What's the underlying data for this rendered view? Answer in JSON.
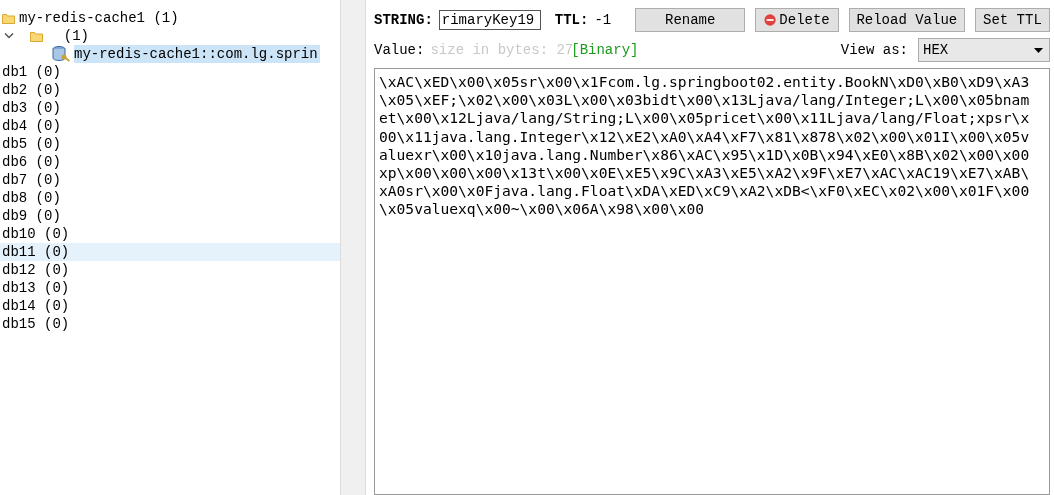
{
  "tree": {
    "connection": {
      "label": "my-redis-cache1 (1)",
      "children": [
        {
          "label": "(1)",
          "expanded": true,
          "children": [
            {
              "label": "my-redis-cache1::com.lg.sprin",
              "selected": true
            }
          ]
        }
      ]
    },
    "databases": [
      {
        "label": "db1 (0)",
        "hovered": false
      },
      {
        "label": "db2 (0)",
        "hovered": false
      },
      {
        "label": "db3 (0)",
        "hovered": false
      },
      {
        "label": "db4 (0)",
        "hovered": false
      },
      {
        "label": "db5 (0)",
        "hovered": false
      },
      {
        "label": "db6 (0)",
        "hovered": false
      },
      {
        "label": "db7 (0)",
        "hovered": false
      },
      {
        "label": "db8 (0)",
        "hovered": false
      },
      {
        "label": "db9 (0)",
        "hovered": false
      },
      {
        "label": "db10 (0)",
        "hovered": false
      },
      {
        "label": "db11 (0)",
        "hovered": true
      },
      {
        "label": "db12 (0)",
        "hovered": false
      },
      {
        "label": "db13 (0)",
        "hovered": false
      },
      {
        "label": "db14 (0)",
        "hovered": false
      },
      {
        "label": "db15 (0)",
        "hovered": false
      }
    ]
  },
  "key_bar": {
    "type_label": "STRING:",
    "key_value": "rimaryKey19",
    "ttl_label": "TTL:",
    "ttl_value": "-1",
    "buttons": [
      {
        "label": "Rename",
        "kind": "plain"
      },
      {
        "label": "Delete",
        "kind": "delete"
      },
      {
        "label": "Reload Value",
        "kind": "plain"
      },
      {
        "label": "Set TTL",
        "kind": "plain"
      }
    ]
  },
  "value_bar": {
    "label": "Value:",
    "size_placeholder": "size in bytes: 27",
    "format_tag": "[Binary]",
    "view_as_label": "View as:",
    "view_as_value": "HEX"
  },
  "value_lines": [
    "\\xAC\\xED\\x00\\x05sr\\x00\\x1Fcom.lg.springboot02.entity.BookN\\xD0\\xB0\\xD9\\xA3",
    "\\x05\\xEF;\\x02\\x00\\x03L\\x00\\x03bidt\\x00\\x13Ljava/lang/Integer;L\\x00\\x05bnam",
    "et\\x00\\x12Ljava/lang/String;L\\x00\\x05pricet\\x00\\x11Ljava/lang/Float;xpsr\\x",
    "00\\x11java.lang.Integer\\x12\\xE2\\xA0\\xA4\\xF7\\x81\\x878\\x02\\x00\\x01I\\x00\\x05v",
    "aluexr\\x00\\x10java.lang.Number\\x86\\xAC\\x95\\x1D\\x0B\\x94\\xE0\\x8B\\x02\\x00\\x00",
    "xp\\x00\\x00\\x00\\x13t\\x00\\x0E\\xE5\\x9C\\xA3\\xE5\\xA2\\x9F\\xE7\\xAC\\xAC19\\xE7\\xAB\\",
    "xA0sr\\x00\\x0Fjava.lang.Float\\xDA\\xED\\xC9\\xA2\\xDB<\\xF0\\xEC\\x02\\x00\\x01F\\x00",
    "\\x05valuexq\\x00~\\x00\\x06A\\x98\\x00\\x00"
  ]
}
